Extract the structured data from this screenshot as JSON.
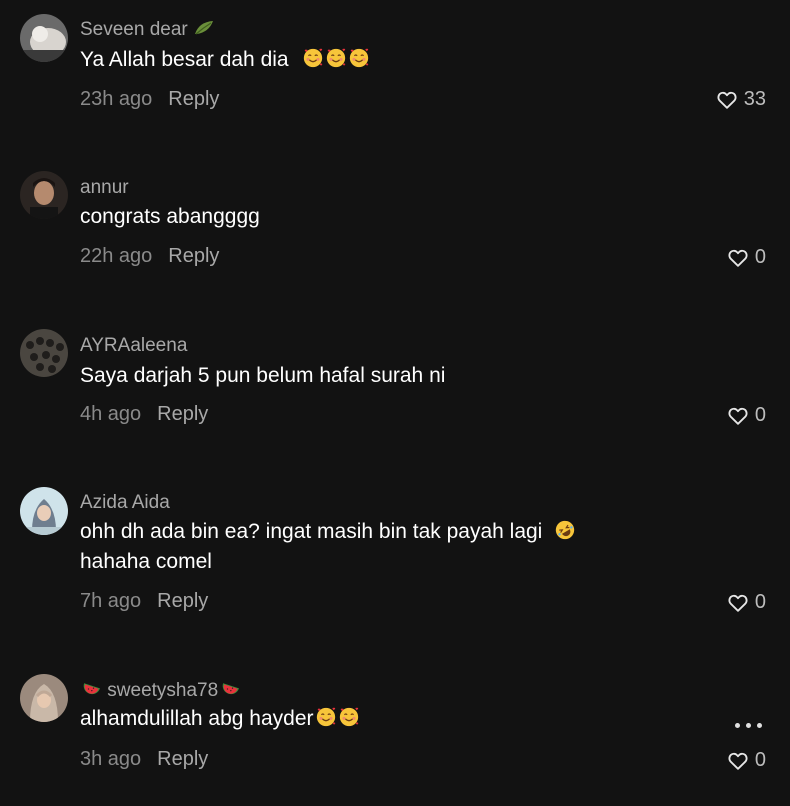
{
  "comments": [
    {
      "username": "Seveen dear",
      "text": "Ya Allah besar dah dia",
      "time": "23h ago",
      "reply": "Reply",
      "likes": "33",
      "username_icon": "leaf-icon",
      "emoji": "smiling-face-with-hearts-icon"
    },
    {
      "username": "annur",
      "text": "congrats abangggg",
      "time": "22h ago",
      "reply": "Reply",
      "likes": "0"
    },
    {
      "username": "AYRAaleena",
      "text": "Saya darjah 5 pun belum hafal surah ni",
      "time": "4h ago",
      "reply": "Reply",
      "likes": "0"
    },
    {
      "username": "Azida Aida",
      "text_line1": "ohh dh ada bin ea? ingat masih bin tak payah lagi",
      "text_line2": "hahaha comel",
      "time": "7h ago",
      "reply": "Reply",
      "likes": "0",
      "emoji": "rolling-on-floor-laughing-icon"
    },
    {
      "username": "sweetysha78",
      "text": "alhamdulillah abg hayder",
      "time": "3h ago",
      "reply": "Reply",
      "likes": "0",
      "username_icon": "watermelon-icon",
      "emoji": "smiling-face-with-hearts-icon"
    }
  ],
  "colors": {
    "background": "#121212",
    "username": "#a8a8a8",
    "text": "#ffffff",
    "meta": "#8a8a8a"
  }
}
